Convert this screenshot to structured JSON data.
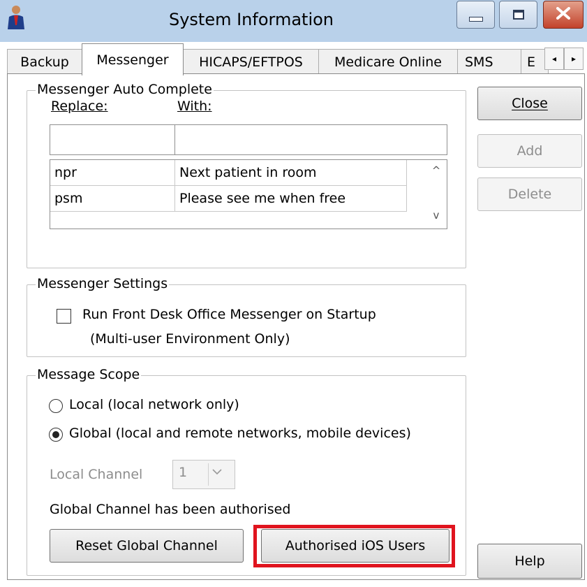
{
  "window": {
    "title": "System Information"
  },
  "title_bar": {
    "icon": "app-person-icon",
    "minimize_icon": "minimize-icon",
    "maximize_icon": "maximize-icon",
    "close_icon": "close-icon"
  },
  "tabs": [
    {
      "label": "Backup"
    },
    {
      "label": "Messenger"
    },
    {
      "label": "HICAPS/EFTPOS"
    },
    {
      "label": "Medicare Online"
    },
    {
      "label": "SMS"
    },
    {
      "label": "E"
    }
  ],
  "tab_scroll": {
    "left": "◂",
    "right": "▸"
  },
  "buttons": {
    "close": "Close",
    "add": "Add",
    "delete": "Delete",
    "help": "Help"
  },
  "auto_complete": {
    "legend": "Messenger Auto Complete",
    "replace_header": "Replace:",
    "with_header": "With:",
    "replace_value": "",
    "with_value": "",
    "rows": [
      {
        "replace": "npr",
        "with": "Next patient in room"
      },
      {
        "replace": "psm",
        "with": "Please see me when free"
      }
    ],
    "scroll_up": "^",
    "scroll_down": "v"
  },
  "messenger_settings": {
    "legend": "Messenger Settings",
    "startup_label": "Run Front Desk Office Messenger on Startup",
    "startup_note": "(Multi-user Environment Only)",
    "startup_checked": false
  },
  "message_scope": {
    "legend": "Message Scope",
    "local_label": "Local (local network only)",
    "global_label": "Global (local and remote networks, mobile devices)",
    "selected": "global",
    "local_channel_label": "Local Channel",
    "local_channel_value": "1",
    "status_text": "Global Channel has been authorised",
    "reset_button": "Reset Global Channel",
    "ios_button": "Authorised iOS Users"
  },
  "colors": {
    "highlight": "#e0141e",
    "title_bar": "#b9d1ea",
    "close_button": "#c3422b"
  }
}
